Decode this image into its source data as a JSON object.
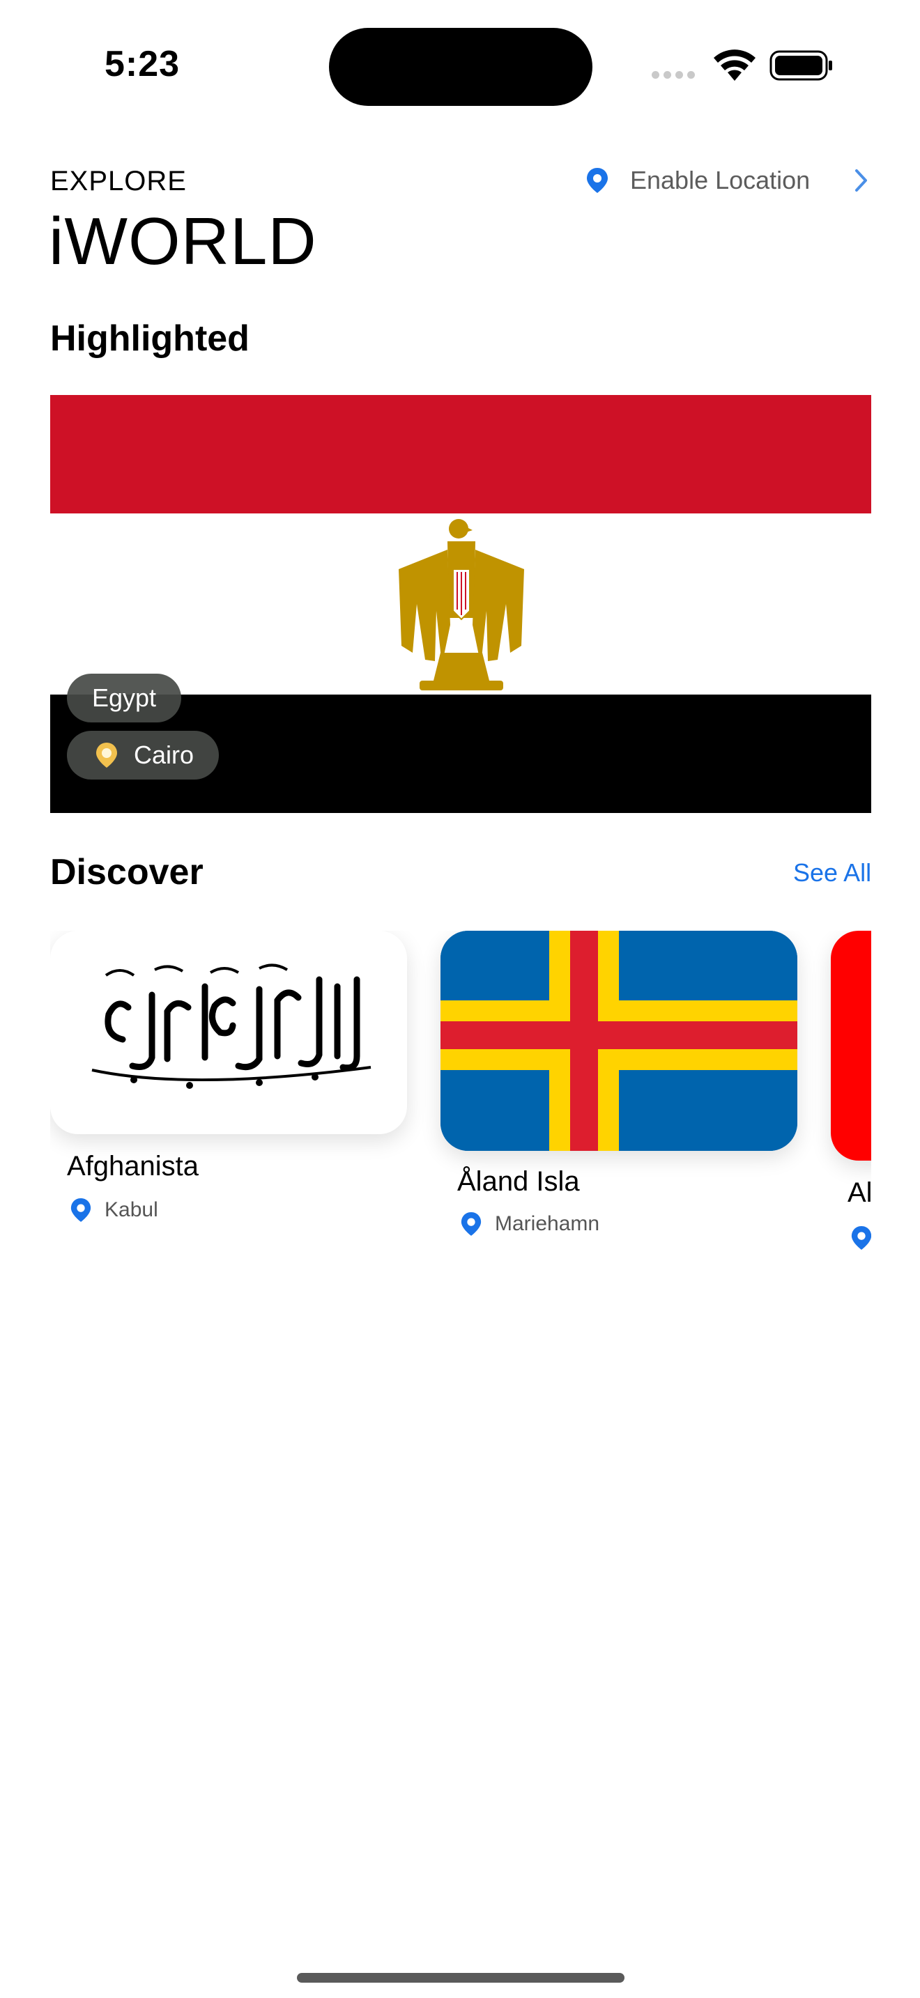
{
  "status_bar": {
    "time": "5:23"
  },
  "header": {
    "eyebrow": "EXPLORE",
    "title": "iWORLD",
    "location_button": {
      "label": "Enable Location"
    }
  },
  "highlighted": {
    "section_title": "Highlighted",
    "country": "Egypt",
    "capital": "Cairo",
    "flag_colors": [
      "#ce1126",
      "#ffffff",
      "#000000"
    ]
  },
  "discover": {
    "section_title": "Discover",
    "see_all": "See All",
    "items": [
      {
        "name": "Afghanista",
        "capital": "Kabul",
        "flag": "afghanistan-flag"
      },
      {
        "name": "Åland Isla",
        "capital": "Mariehamn",
        "flag": "aland-islands-flag"
      },
      {
        "name": "Al",
        "capital": "",
        "flag": "red-flag"
      }
    ]
  },
  "colors": {
    "accent": "#1a73e8",
    "pin_blue": "#1a73e8",
    "pin_gold": "#f2c14e"
  }
}
